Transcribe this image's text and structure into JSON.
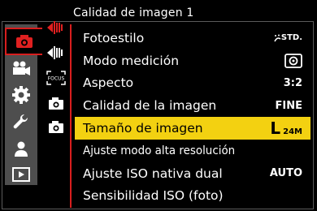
{
  "header": {
    "title": "Calidad de imagen 1"
  },
  "main_tabs": [
    {
      "icon": "camera-icon",
      "active": true
    },
    {
      "icon": "video-camera-icon",
      "active": false
    },
    {
      "icon": "gear-icon",
      "active": false
    },
    {
      "icon": "wrench-icon",
      "active": false
    },
    {
      "icon": "person-icon",
      "active": false
    },
    {
      "icon": "playback-icon",
      "active": false
    }
  ],
  "sub_tabs": [
    {
      "icon": "quality-1-icon"
    },
    {
      "icon": "quality-2-icon"
    },
    {
      "icon": "focus-icon",
      "text": "FOCUS"
    },
    {
      "icon": "camera-sub-icon"
    },
    {
      "icon": "camera-sub-2-icon"
    }
  ],
  "menu": {
    "items": [
      {
        "label": "Fotoestilo",
        "value": "STD."
      },
      {
        "label": "Modo medición",
        "value": ""
      },
      {
        "label": "Aspecto",
        "value": "3:2"
      },
      {
        "label": "Calidad de la imagen",
        "value": "FINE"
      },
      {
        "label": "Tamaño de imagen",
        "value_main": "L",
        "value_sub": "24M",
        "selected": true
      },
      {
        "label": "Ajuste modo alta resolución",
        "value": ""
      },
      {
        "label": "Ajuste ISO nativa dual",
        "value": "AUTO"
      },
      {
        "label": "Sensibilidad ISO (foto)",
        "value": ""
      }
    ]
  },
  "colors": {
    "accent_red": "#d81e1e",
    "highlight_yellow": "#f3d111",
    "tab_gray": "#4e4e4e"
  }
}
